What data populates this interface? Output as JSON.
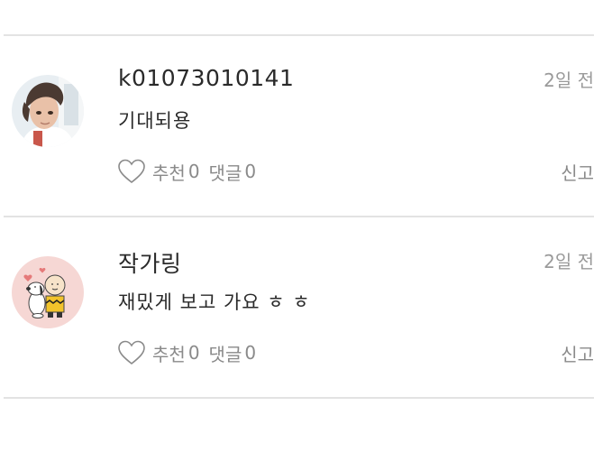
{
  "comments": [
    {
      "username": "k01073010141",
      "time": "2일 전",
      "text": "기대되용",
      "like_label": "추천",
      "like_count": "0",
      "reply_label": "댓글",
      "reply_count": "0",
      "report_label": "신고",
      "avatar": "person-photo"
    },
    {
      "username": "작가링",
      "time": "2일 전",
      "text": "재밌게 보고 가요 ㅎ ㅎ",
      "like_label": "추천",
      "like_count": "0",
      "reply_label": "댓글",
      "reply_count": "0",
      "report_label": "신고",
      "avatar": "snoopy-charlie-illustration"
    }
  ],
  "icons": {
    "like": "heart-outline-icon"
  },
  "colors": {
    "divider": "#e3e3e3",
    "muted_text": "#8a8a8a",
    "time_text": "#9a9a9a",
    "main_text": "#2a2a2a",
    "avatar_pink_bg": "#f6d7d4"
  }
}
